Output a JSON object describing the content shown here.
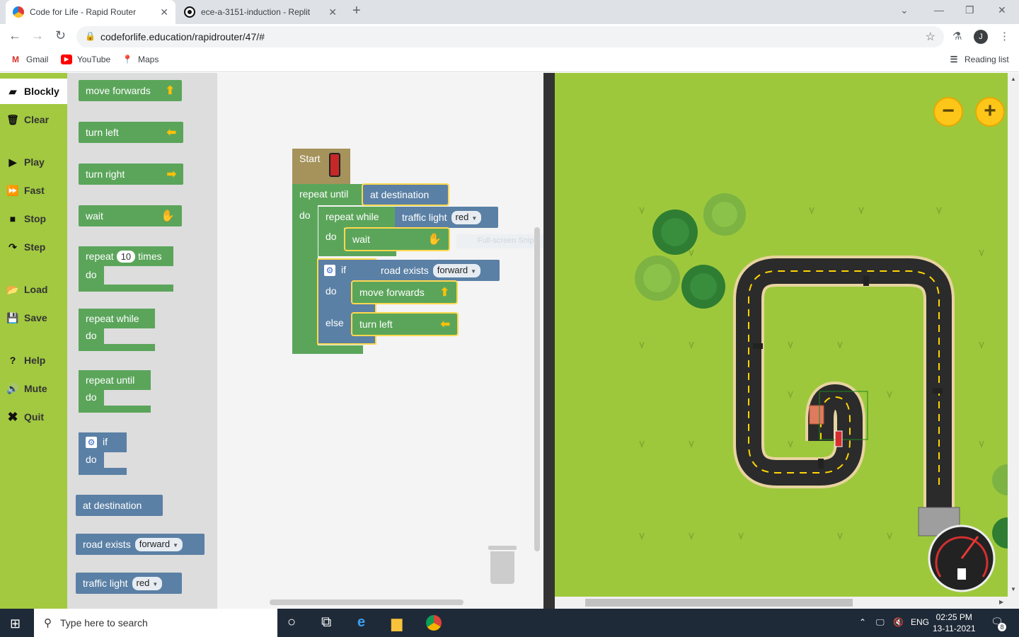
{
  "browser": {
    "tabs": [
      {
        "title": "Code for Life - Rapid Router",
        "active": true
      },
      {
        "title": "ece-a-3151-induction - Replit",
        "active": false
      }
    ],
    "url": "codeforlife.education/rapidrouter/47/#",
    "profile_initial": "J",
    "bookmarks": [
      "Gmail",
      "YouTube",
      "Maps"
    ],
    "reading_list": "Reading list"
  },
  "menu": {
    "items": [
      "Blockly",
      "Clear",
      "Play",
      "Fast",
      "Stop",
      "Step",
      "Load",
      "Save",
      "Help",
      "Mute",
      "Quit"
    ],
    "active": "Blockly"
  },
  "toolbox": {
    "move_forwards": "move forwards",
    "turn_left": "turn left",
    "turn_right": "turn right",
    "wait": "wait",
    "repeat": "repeat",
    "repeat_count": "10",
    "times": "times",
    "do": "do",
    "repeat_while": "repeat while",
    "repeat_until": "repeat until",
    "if": "if",
    "at_destination": "at destination",
    "road_exists": "road exists",
    "road_exists_option": "forward",
    "traffic_light": "traffic light",
    "traffic_light_option": "red"
  },
  "workspace": {
    "start": "Start",
    "repeat_until": "repeat until",
    "at_destination": "at destination",
    "do": "do",
    "repeat_while": "repeat while",
    "traffic_light": "traffic light",
    "traffic_light_option": "red",
    "wait": "wait",
    "if": "if",
    "road_exists": "road exists",
    "road_exists_option": "forward",
    "move_forwards": "move forwards",
    "else": "else",
    "turn_left": "turn left",
    "ghost_text": "Full-screen Snip"
  },
  "map": {
    "zoom_out": "−",
    "zoom_in": "+"
  },
  "taskbar": {
    "search_placeholder": "Type here to search",
    "language": "ENG",
    "time": "02:25 PM",
    "date": "13-11-2021",
    "notifications": "8"
  },
  "colors": {
    "menu_green": "#a2c940",
    "block_green": "#5ba55b",
    "block_blue": "#5b80a5",
    "block_start": "#a5935b",
    "grass": "#9ec83c"
  }
}
